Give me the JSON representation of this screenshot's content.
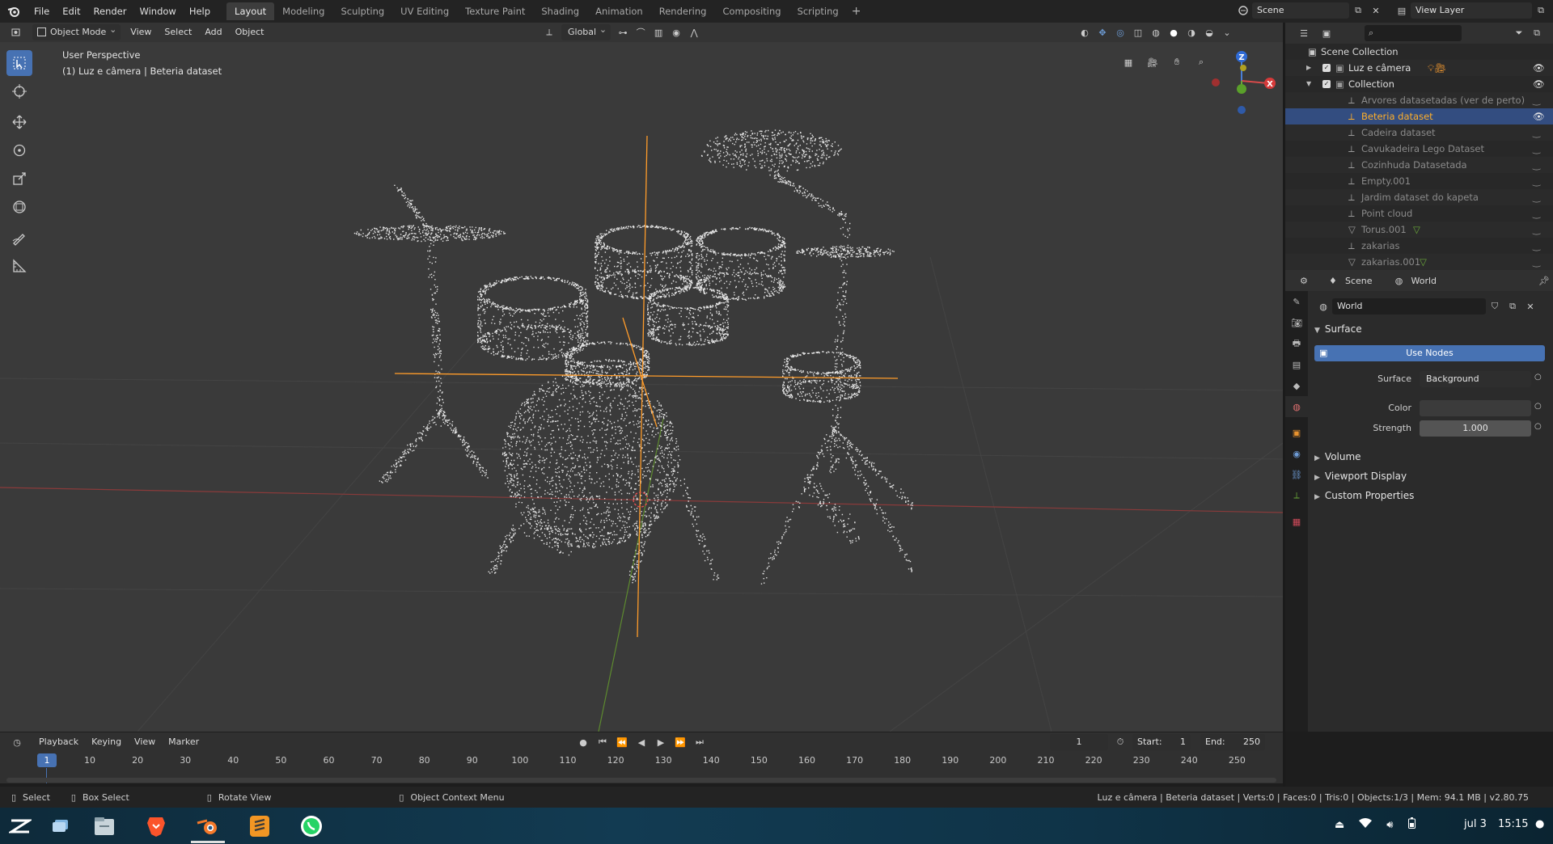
{
  "topbar": {
    "menus": [
      "File",
      "Edit",
      "Render",
      "Window",
      "Help"
    ],
    "workspaces": [
      "Layout",
      "Modeling",
      "Sculpting",
      "UV Editing",
      "Texture Paint",
      "Shading",
      "Animation",
      "Rendering",
      "Compositing",
      "Scripting"
    ],
    "active_workspace": "Layout",
    "scene_name": "Scene",
    "view_layer": "View Layer"
  },
  "viewport": {
    "mode": "Object Mode",
    "menus": [
      "View",
      "Select",
      "Add",
      "Object"
    ],
    "transform_orientation": "Global",
    "overlay_title": "User Perspective",
    "overlay_subtitle": "(1) Luz e câmera | Beteria dataset",
    "gizmo_axes": [
      "Z",
      "X"
    ]
  },
  "outliner": {
    "search_placeholder": "",
    "root": "Scene Collection",
    "items": [
      {
        "label": "Luz e câmera",
        "level": 1,
        "kind": "collection",
        "visible": true
      },
      {
        "label": "Collection",
        "level": 1,
        "kind": "collection",
        "visible": true
      },
      {
        "label": "Arvores datasetadas (ver de perto)",
        "level": 2,
        "kind": "object",
        "visible": false
      },
      {
        "label": "Beteria dataset",
        "level": 2,
        "kind": "object",
        "visible": true,
        "selected": true
      },
      {
        "label": "Cadeira dataset",
        "level": 2,
        "kind": "object",
        "visible": false
      },
      {
        "label": "Cavukadeira Lego Dataset",
        "level": 2,
        "kind": "object",
        "visible": false
      },
      {
        "label": "Cozinhuda Datasetada",
        "level": 2,
        "kind": "object",
        "visible": false
      },
      {
        "label": "Empty.001",
        "level": 2,
        "kind": "object",
        "visible": false
      },
      {
        "label": "Jardim dataset do kapeta",
        "level": 2,
        "kind": "object",
        "visible": false
      },
      {
        "label": "Point cloud",
        "level": 2,
        "kind": "object",
        "visible": false
      },
      {
        "label": "Torus.001",
        "level": 2,
        "kind": "mesh",
        "visible": false
      },
      {
        "label": "zakarias",
        "level": 2,
        "kind": "object",
        "visible": false
      },
      {
        "label": "zakarias.001",
        "level": 2,
        "kind": "mesh",
        "visible": false
      }
    ]
  },
  "properties": {
    "breadcrumb_scene": "Scene",
    "breadcrumb_world": "World",
    "world_name": "World",
    "panels": {
      "surface": "Surface",
      "use_nodes": "Use Nodes",
      "surface_label": "Surface",
      "surface_value": "Background",
      "color_label": "Color",
      "strength_label": "Strength",
      "strength_value": "1.000",
      "volume": "Volume",
      "viewport_display": "Viewport Display",
      "custom_properties": "Custom Properties"
    }
  },
  "timeline": {
    "menus": [
      "Playback",
      "Keying",
      "View",
      "Marker"
    ],
    "current_frame": "1",
    "start_label": "Start:",
    "start_value": "1",
    "end_label": "End:",
    "end_value": "250",
    "ruler": [
      "10",
      "20",
      "30",
      "40",
      "50",
      "60",
      "70",
      "80",
      "90",
      "100",
      "110",
      "120",
      "130",
      "140",
      "150",
      "160",
      "170",
      "180",
      "190",
      "200",
      "210",
      "220",
      "230",
      "240",
      "250"
    ],
    "playhead": "1"
  },
  "statusbar": {
    "select": "Select",
    "box_select": "Box Select",
    "rotate_view": "Rotate View",
    "context_menu": "Object Context Menu",
    "info": "Luz e câmera | Beteria dataset | Verts:0 | Faces:0 | Tris:0 | Objects:1/3 | Mem: 94.1 MB | v2.80.75"
  },
  "taskbar": {
    "date": "jul 3",
    "time": "15:15"
  },
  "colors": {
    "accent": "#4772b3",
    "selected_text": "#ffaf29",
    "header_bg": "#232323",
    "viewport_bg": "#3a3a3a"
  }
}
